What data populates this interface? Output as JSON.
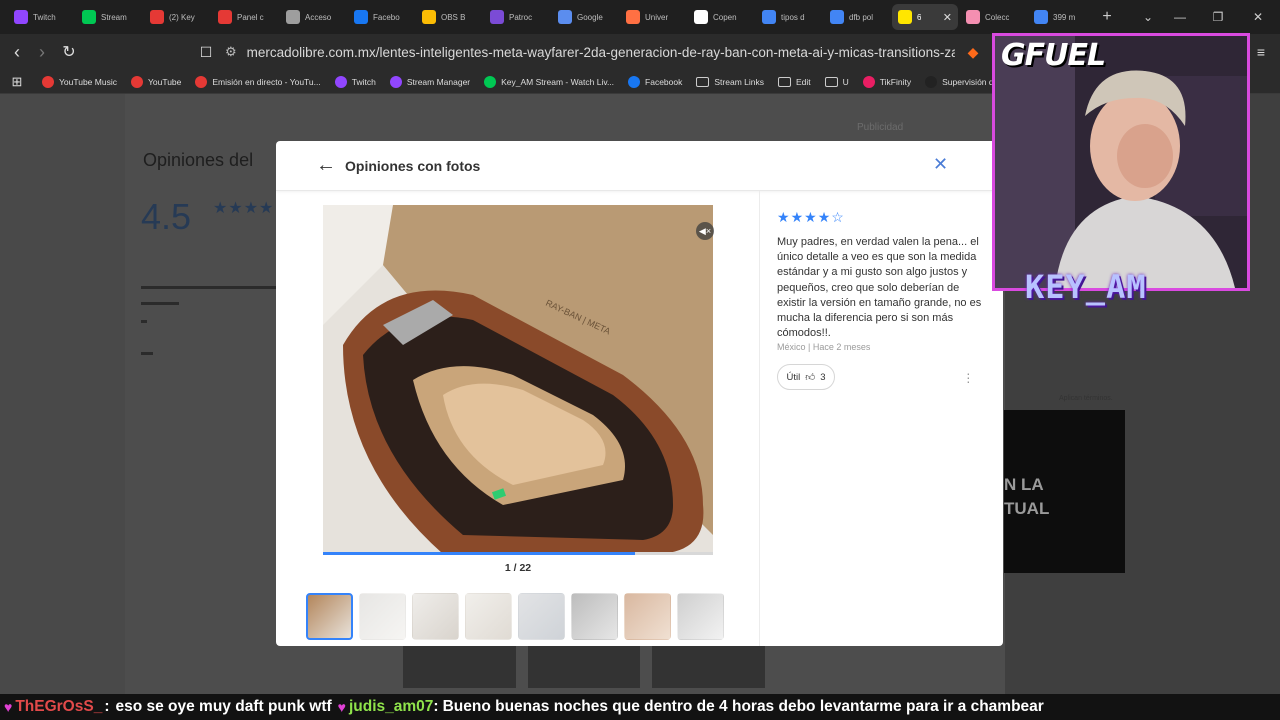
{
  "browser": {
    "tabs": [
      {
        "label": "Twitch",
        "color": "#9146ff",
        "active": false
      },
      {
        "label": "Stream",
        "color": "#00c853",
        "active": false
      },
      {
        "label": "(2) Key",
        "color": "#e53935",
        "active": false
      },
      {
        "label": "Panel c",
        "color": "#e53935",
        "active": false
      },
      {
        "label": "Acceso",
        "color": "#9e9e9e",
        "active": false
      },
      {
        "label": "Facebo",
        "color": "#1877f2",
        "active": false
      },
      {
        "label": "OBS B",
        "color": "#fbbc04",
        "active": false
      },
      {
        "label": "Patroc",
        "color": "#7b4bd6",
        "active": false
      },
      {
        "label": "Google",
        "color": "#5b8def",
        "active": false
      },
      {
        "label": "Univer",
        "color": "#ff7043",
        "active": false
      },
      {
        "label": "Copen",
        "color": "#ffffff",
        "active": false
      },
      {
        "label": "tipos d",
        "color": "#4285f4",
        "active": false
      },
      {
        "label": "dfb pol",
        "color": "#4285f4",
        "active": false
      },
      {
        "label": "6",
        "color": "#ffe600",
        "active": true
      },
      {
        "label": "Colecc",
        "color": "#f48fb1",
        "active": false
      },
      {
        "label": "399 m",
        "color": "#4285f4",
        "active": false
      }
    ],
    "new_tab": "+",
    "url": "mercadolibre.com.mx/lentes-inteligentes-meta-wayfarer-2da-generacion-de-ray-ban-con-meta-ai-y-micas-transitions-zafiro/...",
    "bookmarks": [
      {
        "label": "YouTube Music",
        "color": "#e53935",
        "type": "site"
      },
      {
        "label": "YouTube",
        "color": "#e53935",
        "type": "site"
      },
      {
        "label": "Emisión en directo - YouTu...",
        "color": "#e53935",
        "type": "site"
      },
      {
        "label": "Twitch",
        "color": "#9146ff",
        "type": "site"
      },
      {
        "label": "Stream Manager",
        "color": "#9146ff",
        "type": "site"
      },
      {
        "label": "Key_AM Stream - Watch Liv...",
        "color": "#00c853",
        "type": "site"
      },
      {
        "label": "Facebook",
        "color": "#1877f2",
        "type": "site"
      },
      {
        "label": "Stream Links",
        "color": "",
        "type": "folder"
      },
      {
        "label": "Edit",
        "color": "",
        "type": "folder"
      },
      {
        "label": "U",
        "color": "",
        "type": "folder"
      },
      {
        "label": "TikFinity",
        "color": "#e91e63",
        "type": "site"
      },
      {
        "label": "Supervisión del LI",
        "color": "#222222",
        "type": "site"
      }
    ]
  },
  "background_page": {
    "title": "Opiniones del",
    "rating": "4.5",
    "publicidad": "Publicidad",
    "ad_text_1": "N LA",
    "ad_text_2": "TUAL",
    "ad_caption": "Aplican términos."
  },
  "modal": {
    "title": "Opiniones con fotos",
    "counter": "1 / 22",
    "progress": 0.8,
    "stars_filled": 4,
    "stars_total": 5,
    "review_text": "Muy padres, en verdad valen la pena... el único detalle a veo es que son la medida estándar y a mi gusto son algo justos y pequeños, creo que solo deberían de existir la versión en tamaño grande, no es mucha la diferencia pero si son más cómodos!!.",
    "review_meta": "México | Hace 2 meses",
    "helpful_label": "Útil",
    "helpful_count": "3"
  },
  "overlay": {
    "brand": "GFUEL",
    "streamer": "KEY_AM",
    "accent": "#d94ae0"
  },
  "chat": [
    {
      "user": "ThEGrOsS_",
      "message": "eso se oye muy daft punk wtf",
      "color": "#e24a4a"
    },
    {
      "user": "judis_am07",
      "message": "Bueno buenas noches que dentro de 4 horas debo levantarme para ir a chambear",
      "color": "#8fe34b"
    }
  ]
}
